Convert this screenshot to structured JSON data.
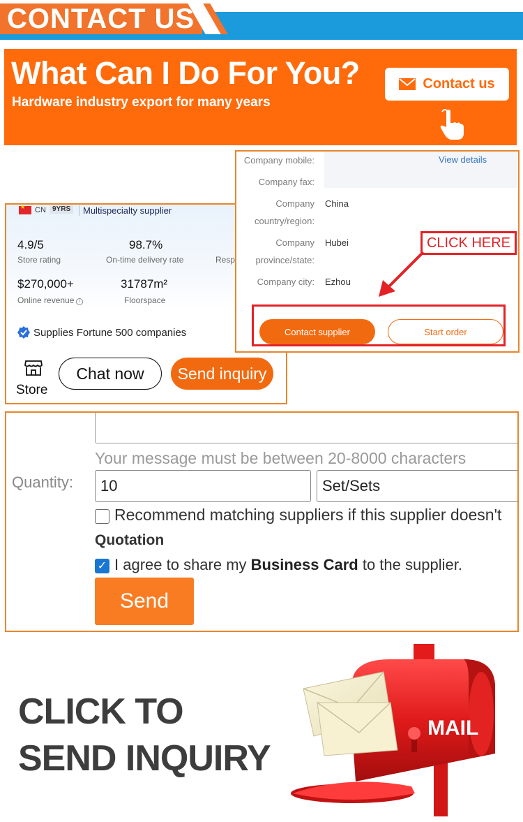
{
  "header": {
    "title": "CONTACT US"
  },
  "hero": {
    "title": "What Can I Do For You?",
    "subtitle": "Hardware industry export for many years",
    "contact_button": "Contact us",
    "button_icon": "envelope-icon",
    "pointer_icon": "hand-pointer-icon"
  },
  "store_card": {
    "country": "CN",
    "years": "9YRS",
    "supplier_type": "Multispecialty supplier",
    "stats": [
      {
        "value": "4.9/5",
        "label": "Store rating"
      },
      {
        "value": "98.7%",
        "label": "On-time delivery rate"
      },
      {
        "value": "",
        "label": "Respo"
      },
      {
        "value": "$270,000+",
        "label": "Online revenue"
      },
      {
        "value": "31787m²",
        "label": "Floorspace"
      }
    ],
    "fortune": "Supplies Fortune 500 companies",
    "store_label": "Store",
    "chat_button": "Chat now",
    "inquiry_button": "Send inquiry"
  },
  "company_details": {
    "rows": [
      {
        "label": "Company mobile:",
        "value": ""
      },
      {
        "label": "Company fax:",
        "value": ""
      },
      {
        "label": "Company country/region:",
        "value": "China"
      },
      {
        "label": "Company province/state:",
        "value": "Hubei"
      },
      {
        "label": "Company city:",
        "value": "Ezhou"
      }
    ],
    "view_details": "View details",
    "callout": "CLICK HERE",
    "contact_supplier": "Contact supplier",
    "start_order": "Start order"
  },
  "inquiry_form": {
    "hint": "Your message must be between 20-8000 characters",
    "quantity_label": "Quantity:",
    "quantity_value": "10",
    "unit_value": "Set/Sets",
    "recommend_label": "Recommend matching suppliers if this supplier doesn't",
    "quotation": "Quotation",
    "agree_pre": "I agree to share my ",
    "agree_bold": "Business Card",
    "agree_post": " to the supplier.",
    "agree_checked": true,
    "send_button": "Send"
  },
  "cta": {
    "line1": "CLICK TO",
    "line2": "SEND INQUIRY"
  },
  "mailbox": {
    "label": "MAIL"
  },
  "colors": {
    "orange": "#ff6b0b",
    "blue": "#1b9bdc",
    "red": "#e32227",
    "border": "#e6862d"
  }
}
